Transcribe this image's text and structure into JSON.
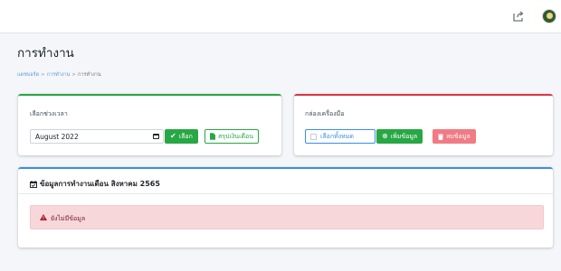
{
  "topbar": {
    "share_icon": "share-icon",
    "avatar_icon": "user-avatar"
  },
  "page": {
    "title": "การทำงาน"
  },
  "breadcrumb": {
    "items": [
      "แดชบอร์ด",
      "การทำงาน",
      "การทำงาน"
    ],
    "separator": ">"
  },
  "select_period": {
    "label": "เลือกช่วงเวลา",
    "month_value": "August 2022",
    "select_button": "เลือก",
    "summary_button": "สรุปเงินเดือน"
  },
  "toolbox": {
    "label": "กล่องเครื่องมือ",
    "select_all": "เลือกทั้งหมด",
    "add_button": "เพิ่มข้อมูล",
    "delete_button": "ลบข้อมูล"
  },
  "work_data": {
    "title": "ข้อมูลการทำงานเดือน สิงหาคม 2565",
    "alert": "ยังไม่มีข้อมูล"
  },
  "colors": {
    "success": "#28a745",
    "danger": "#dc3545",
    "primary": "#3a8ee6",
    "alert_bg": "#f8d7da"
  }
}
